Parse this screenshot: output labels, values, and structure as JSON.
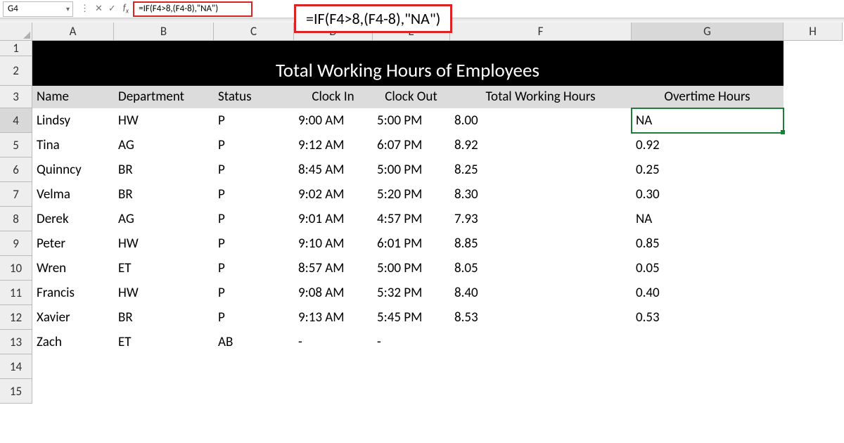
{
  "formula_bar": {
    "cell_ref": "G4",
    "formula": "=IF(F4>8,(F4-8),\"NA\")"
  },
  "overlay_formula": "=IF(F4>8,(F4-8),\"NA\")",
  "columns": [
    "A",
    "B",
    "C",
    "D",
    "E",
    "F",
    "G",
    "H"
  ],
  "row_numbers": [
    "1",
    "2",
    "3",
    "4",
    "5",
    "6",
    "7",
    "8",
    "9",
    "10",
    "11",
    "12",
    "13",
    "14",
    "15"
  ],
  "title": "Total Working Hours of Employees",
  "headers": {
    "name": "Name",
    "dept": "Department",
    "status": "Status",
    "clockin": "Clock In",
    "clockout": "Clock Out",
    "total": "Total Working Hours",
    "overtime": "Overtime Hours"
  },
  "rows": [
    {
      "name": "Lindsy",
      "dept": "HW",
      "status": "P",
      "in": "9:00 AM",
      "out": "5:00 PM",
      "total": "8.00",
      "ot": "NA",
      "ot_align": "center",
      "active": true
    },
    {
      "name": "Tina",
      "dept": "AG",
      "status": "P",
      "in": "9:12 AM",
      "out": "6:07 PM",
      "total": "8.92",
      "ot": "0.92",
      "ot_align": "right"
    },
    {
      "name": "Quinncy",
      "dept": "BR",
      "status": "P",
      "in": "8:45 AM",
      "out": "5:00 PM",
      "total": "8.25",
      "ot": "0.25",
      "ot_align": "right"
    },
    {
      "name": "Velma",
      "dept": "BR",
      "status": "P",
      "in": "9:02 AM",
      "out": "5:20 PM",
      "total": "8.30",
      "ot": "0.30",
      "ot_align": "right"
    },
    {
      "name": "Derek",
      "dept": "AG",
      "status": "P",
      "in": "9:01 AM",
      "out": "4:57 PM",
      "total": "7.93",
      "ot": "NA",
      "ot_align": "center"
    },
    {
      "name": "Peter",
      "dept": "HW",
      "status": "P",
      "in": "9:10 AM",
      "out": "6:01 PM",
      "total": "8.85",
      "ot": "0.85",
      "ot_align": "right"
    },
    {
      "name": "Wren",
      "dept": "ET",
      "status": "P",
      "in": "8:57 AM",
      "out": "5:00 PM",
      "total": "8.05",
      "ot": "0.05",
      "ot_align": "right"
    },
    {
      "name": "Francis",
      "dept": "HW",
      "status": "P",
      "in": "9:08 AM",
      "out": "5:32 PM",
      "total": "8.40",
      "ot": "0.40",
      "ot_align": "right"
    },
    {
      "name": "Xavier",
      "dept": "BR",
      "status": "P",
      "in": "9:13 AM",
      "out": "5:45 PM",
      "total": "8.53",
      "ot": "0.53",
      "ot_align": "right"
    },
    {
      "name": "Zach",
      "dept": "ET",
      "status": "AB",
      "in": "-",
      "out": "-",
      "total": "",
      "ot": "",
      "ot_align": "right"
    }
  ],
  "active_cell": "G4",
  "chart_data": {
    "type": "table",
    "title": "Total Working Hours of Employees",
    "columns": [
      "Name",
      "Department",
      "Status",
      "Clock In",
      "Clock Out",
      "Total Working Hours",
      "Overtime Hours"
    ],
    "rows": [
      [
        "Lindsy",
        "HW",
        "P",
        "9:00 AM",
        "5:00 PM",
        8.0,
        "NA"
      ],
      [
        "Tina",
        "AG",
        "P",
        "9:12 AM",
        "6:07 PM",
        8.92,
        0.92
      ],
      [
        "Quinncy",
        "BR",
        "P",
        "8:45 AM",
        "5:00 PM",
        8.25,
        0.25
      ],
      [
        "Velma",
        "BR",
        "P",
        "9:02 AM",
        "5:20 PM",
        8.3,
        0.3
      ],
      [
        "Derek",
        "AG",
        "P",
        "9:01 AM",
        "4:57 PM",
        7.93,
        "NA"
      ],
      [
        "Peter",
        "HW",
        "P",
        "9:10 AM",
        "6:01 PM",
        8.85,
        0.85
      ],
      [
        "Wren",
        "ET",
        "P",
        "8:57 AM",
        "5:00 PM",
        8.05,
        0.05
      ],
      [
        "Francis",
        "HW",
        "P",
        "9:08 AM",
        "5:32 PM",
        8.4,
        0.4
      ],
      [
        "Xavier",
        "BR",
        "P",
        "9:13 AM",
        "5:45 PM",
        8.53,
        0.53
      ],
      [
        "Zach",
        "ET",
        "AB",
        "-",
        "-",
        null,
        null
      ]
    ]
  }
}
